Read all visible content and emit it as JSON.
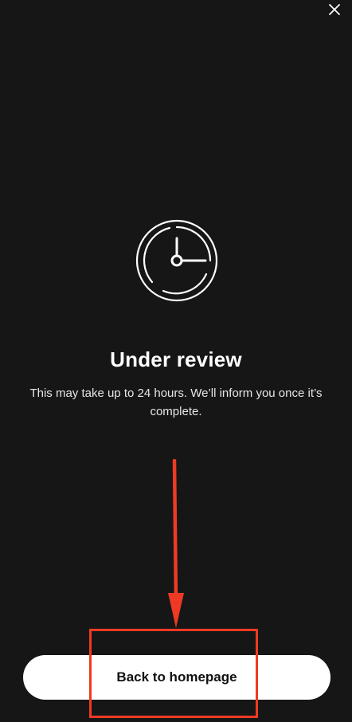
{
  "close": {
    "icon": "close-icon"
  },
  "status": {
    "icon": "clock-icon",
    "title": "Under review",
    "message": "This may take up to 24 hours. We’ll inform you once it’s complete."
  },
  "actions": {
    "back_label": "Back to homepage"
  },
  "annotation": {
    "color": "#ee3a24",
    "arrow_icon": "arrow-down-icon"
  },
  "colors": {
    "background": "#161616",
    "button_bg": "#ffffff",
    "button_text": "#111111"
  }
}
